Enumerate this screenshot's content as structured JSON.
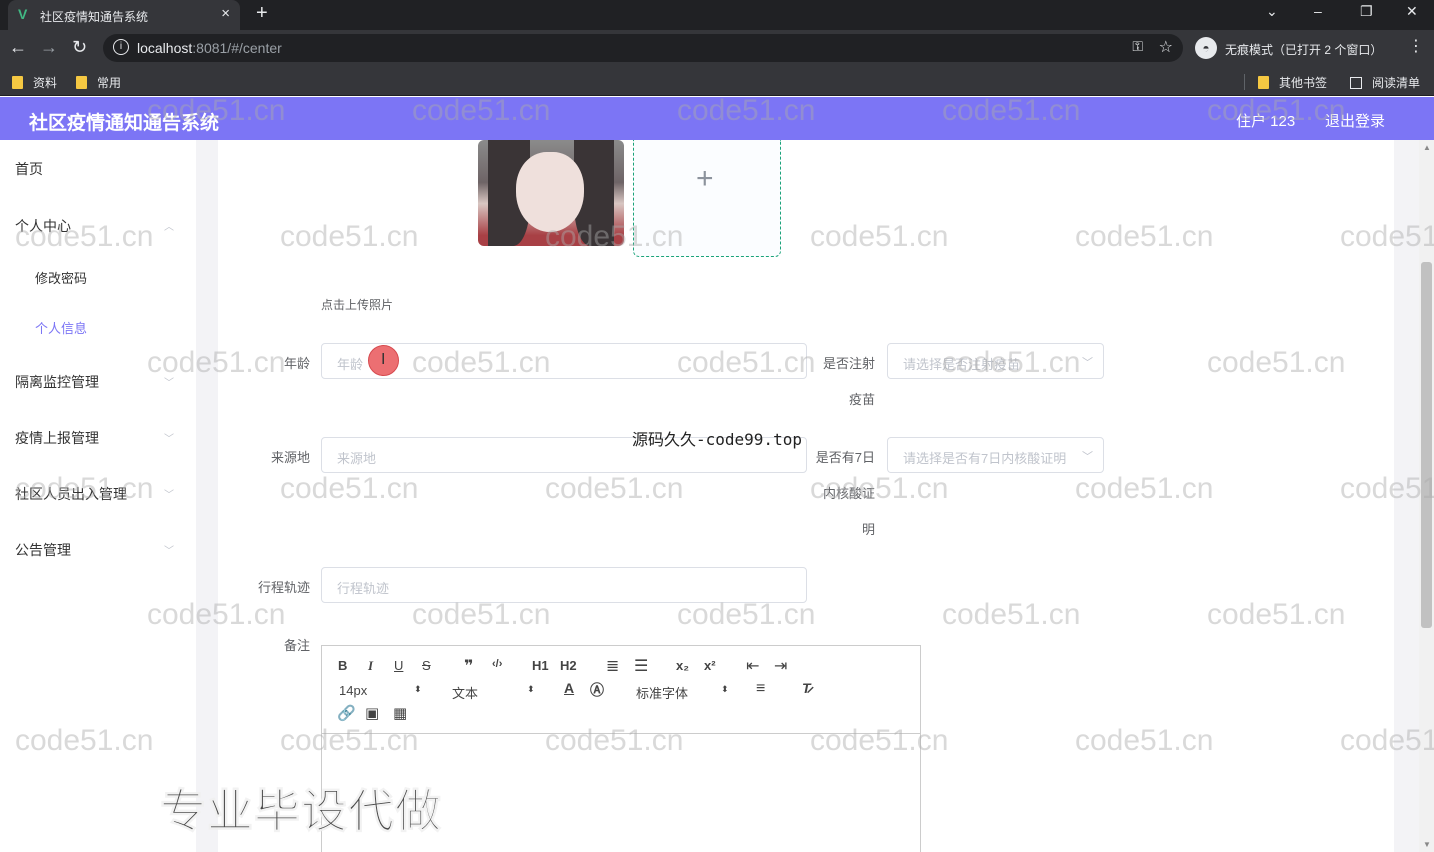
{
  "browser": {
    "tab_title": "社区疫情知通告系统",
    "tab_close": "×",
    "new_tab": "+",
    "window_controls": [
      "⌄",
      "–",
      "❐",
      "✕"
    ],
    "nav": {
      "back": "←",
      "forward": "→",
      "reload": "↻"
    },
    "url_host": "localhost",
    "url_rest": ":8081/#/center",
    "incognito_label": "无痕模式（已打开 2 个窗口）",
    "bookmarks": [
      "资料",
      "常用"
    ],
    "bookmarks_right": [
      "其他书签",
      "阅读清单"
    ]
  },
  "app": {
    "title": "社区疫情通知通告系统",
    "user": "住户 123",
    "logout": "退出登录",
    "accent": "#7c75f5"
  },
  "sidebar": {
    "items": [
      {
        "label": "首页"
      },
      {
        "label": "个人中心"
      },
      {
        "label": "修改密码"
      },
      {
        "label": "个人信息"
      },
      {
        "label": "隔离监控管理"
      },
      {
        "label": "疫情上报管理"
      },
      {
        "label": "社区人员出入管理"
      },
      {
        "label": "公告管理"
      }
    ],
    "active": "个人信息"
  },
  "form": {
    "upload_hint": "点击上传照片",
    "age": {
      "label": "年龄",
      "placeholder": "年龄"
    },
    "vaccinated": {
      "label_1": "是否注射",
      "label_2": "疫苗",
      "placeholder": "请选择是否注射疫苗"
    },
    "origin": {
      "label": "来源地",
      "placeholder": "来源地"
    },
    "nucleic": {
      "label_1": "是否有7日",
      "label_2": "内核酸证",
      "label_3": "明",
      "placeholder": "请选择是否有7日内核酸证明"
    },
    "trajectory": {
      "label": "行程轨迹",
      "placeholder": "行程轨迹"
    },
    "remark": {
      "label": "备注"
    }
  },
  "editor": {
    "font_size": "14px",
    "heading": "文本",
    "font_family": "标准字体",
    "buttons": [
      "B",
      "I",
      "U",
      "S",
      "❞",
      "‹/›",
      "H1",
      "H2",
      "ol",
      "ul",
      "x₂",
      "x²",
      "outdent",
      "indent"
    ]
  },
  "overlays": {
    "source_text": "源码久久-code99.top",
    "promo": "专业毕设代做",
    "watermark": "code51.cn"
  }
}
